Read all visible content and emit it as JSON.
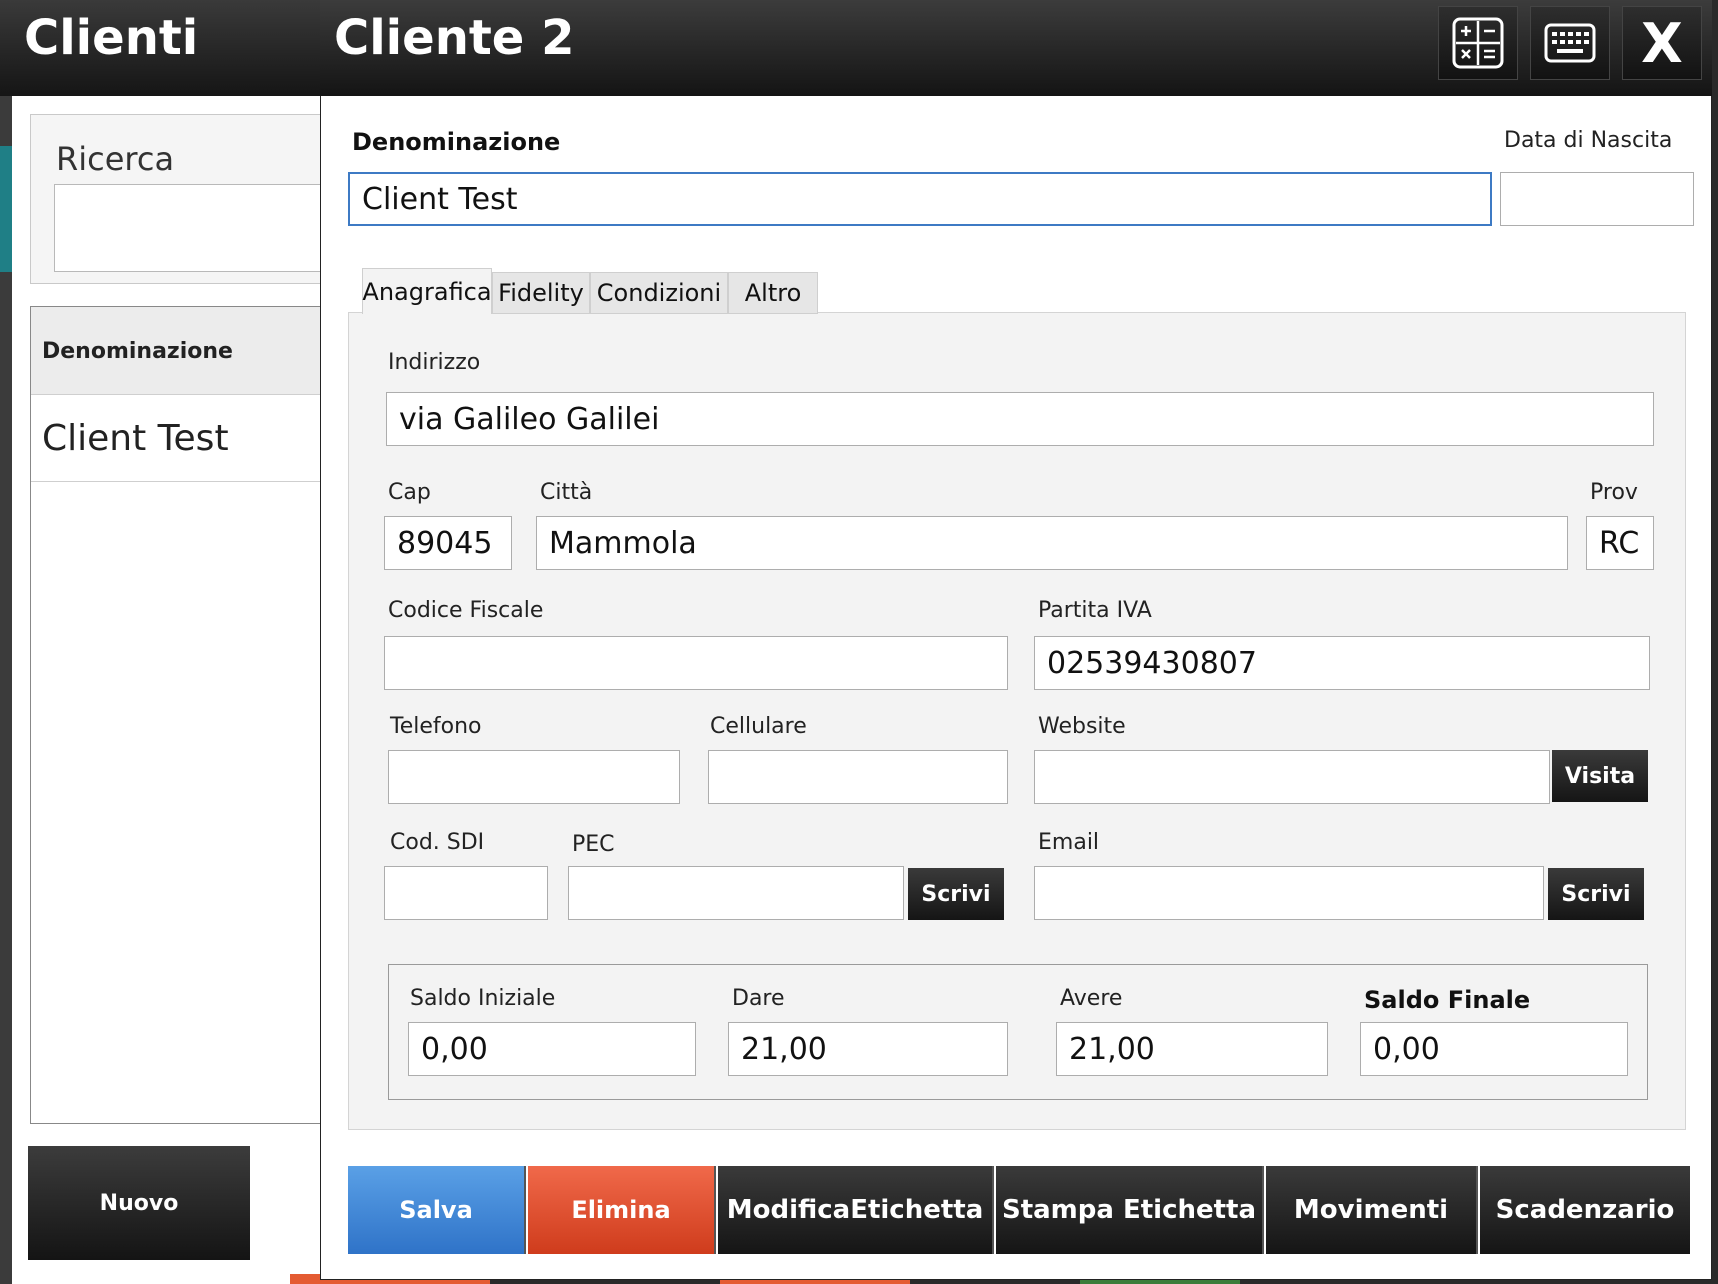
{
  "background_window": {
    "title": "Clienti",
    "search_label": "Ricerca",
    "search_value": "",
    "list_header": "Denominazione",
    "list_items": [
      "Client Test"
    ],
    "new_button": "Nuovo"
  },
  "dialog": {
    "title": "Cliente 2",
    "toolbar": {
      "calculator_icon": "calculator-icon",
      "keyboard_icon": "keyboard-icon",
      "close_label": "X"
    },
    "denominazione_label": "Denominazione",
    "denominazione_value": "Client Test",
    "data_nascita_label": "Data di Nascita",
    "data_nascita_value": "",
    "tabs": [
      "Anagrafica",
      "Fidelity",
      "Condizioni",
      "Altro"
    ],
    "active_tab": "Anagrafica",
    "anagrafica": {
      "indirizzo_label": "Indirizzo",
      "indirizzo_value": "via Galileo Galilei",
      "cap_label": "Cap",
      "cap_value": "89045",
      "citta_label": "Città",
      "citta_value": "Mammola",
      "prov_label": "Prov",
      "prov_value": "RC",
      "codice_fiscale_label": "Codice Fiscale",
      "codice_fiscale_value": "",
      "partita_iva_label": "Partita IVA",
      "partita_iva_value": "02539430807",
      "telefono_label": "Telefono",
      "telefono_value": "",
      "cellulare_label": "Cellulare",
      "cellulare_value": "",
      "website_label": "Website",
      "website_value": "",
      "visita_label": "Visita",
      "cod_sdi_label": "Cod. SDI",
      "cod_sdi_value": "",
      "pec_label": "PEC",
      "pec_value": "",
      "pec_scrivi_label": "Scrivi",
      "email_label": "Email",
      "email_value": "",
      "email_scrivi_label": "Scrivi"
    },
    "saldo": {
      "saldo_iniziale_label": "Saldo Iniziale",
      "saldo_iniziale_value": "0,00",
      "dare_label": "Dare",
      "dare_value": "21,00",
      "avere_label": "Avere",
      "avere_value": "21,00",
      "saldo_finale_label": "Saldo Finale",
      "saldo_finale_value": "0,00"
    },
    "actions": {
      "salva": "Salva",
      "elimina": "Elimina",
      "modifica_etichetta": "ModificaEtichetta",
      "stampa_etichetta": "Stampa Etichetta",
      "movimenti": "Movimenti",
      "scadenzario": "Scadenzario"
    },
    "colors": {
      "salva": "#2f73c8",
      "elimina": "#cf3c1c",
      "focus_border": "#3d7ac4"
    }
  }
}
